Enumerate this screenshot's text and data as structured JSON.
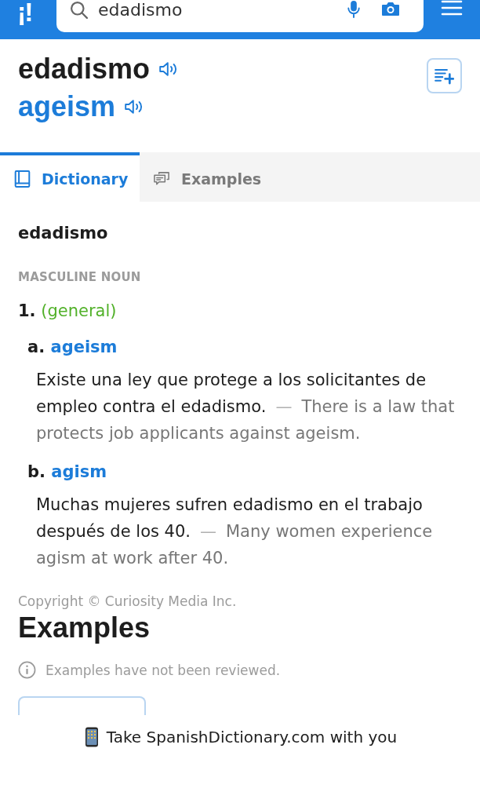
{
  "header": {
    "logo": "¡!",
    "search": {
      "value": "edadismo"
    }
  },
  "entry": {
    "headword": "edadismo",
    "translation": "ageism"
  },
  "tabs": [
    {
      "label": "Dictionary",
      "selected": true
    },
    {
      "label": "Examples",
      "selected": false
    }
  ],
  "dictionary": {
    "word": "edadismo",
    "part_of_speech": "MASCULINE NOUN",
    "senses": [
      {
        "number": "1.",
        "context": "(general)",
        "translations": [
          {
            "letter": "a.",
            "word": "ageism",
            "example": {
              "source": "Existe una ley que protege a los solicitantes de empleo contra el edadismo.",
              "separator": "—",
              "translation": "There is a law that protects job applicants against ageism."
            }
          },
          {
            "letter": "b.",
            "word": "agism",
            "example": {
              "source": "Muchas mujeres sufren edadismo en el trabajo después de los 40.",
              "separator": "—",
              "translation": "Many women experience agism at work after 40."
            }
          }
        ]
      }
    ],
    "copyright": "Copyright © Curiosity Media Inc."
  },
  "examples": {
    "title": "Examples",
    "notice": "Examples have not been reviewed."
  },
  "banner": {
    "text": "Take SpanishDictionary.com with you"
  }
}
